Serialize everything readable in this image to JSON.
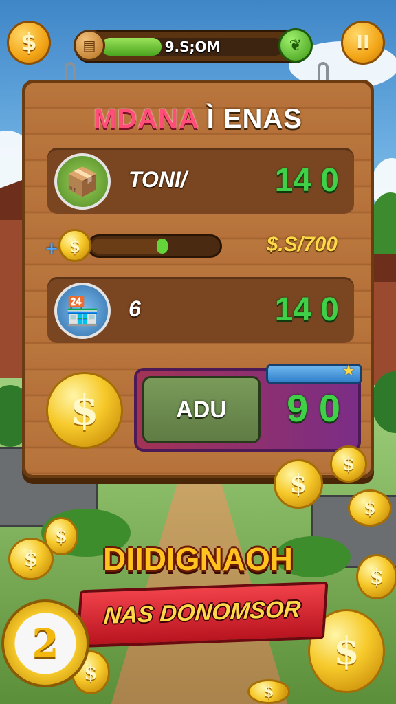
{
  "hud": {
    "coin_button_symbol": "$",
    "progress_text": "9.S;OM",
    "progress_fraction": 0.33,
    "pause_symbol": "II"
  },
  "board": {
    "title_part1": "MDANA",
    "title_part2": "Ì ENAS",
    "row1": {
      "label": "TONI/",
      "value": "14 0"
    },
    "money_text": "$.S/700",
    "row2": {
      "label": "6",
      "value": "14 0"
    },
    "offer": {
      "button_label": "ADU",
      "value": "9 0"
    }
  },
  "coin_symbol": "$",
  "big_coin_number": "2",
  "banner_text": "DIIDIGNAOH",
  "ribbon_text": "NAS DONOMSOR",
  "colors": {
    "value_green": "#3fd048",
    "title_pink": "#ff4f78",
    "gold": "#f6c92a",
    "ribbon_red": "#d8202b"
  }
}
